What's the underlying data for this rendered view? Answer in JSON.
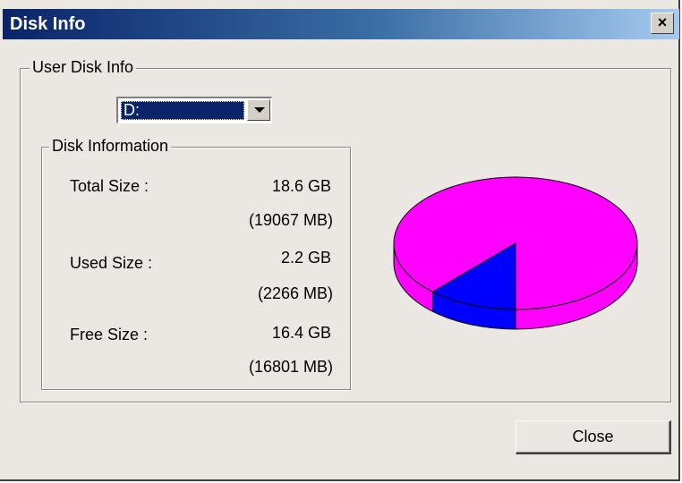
{
  "window": {
    "title": "Disk Info",
    "close_glyph": "×"
  },
  "user_disk_group": {
    "label": "User Disk Info",
    "drive_select": {
      "selected": "D:"
    }
  },
  "disk_info_group": {
    "label": "Disk Information",
    "rows": [
      {
        "label": "Total Size :",
        "value_gb": "18.6 GB",
        "value_mb": "(19067 MB)"
      },
      {
        "label": "Used Size :",
        "value_gb": "2.2 GB",
        "value_mb": "(2266 MB)"
      },
      {
        "label": "Free Size :",
        "value_gb": "16.4 GB",
        "value_mb": "(16801 MB)"
      }
    ]
  },
  "pie_chart": {
    "used_mb": 2266,
    "free_mb": 16801,
    "used_color": "#0000ff",
    "free_color": "#ff00ff"
  },
  "buttons": {
    "close_label": "Close"
  }
}
